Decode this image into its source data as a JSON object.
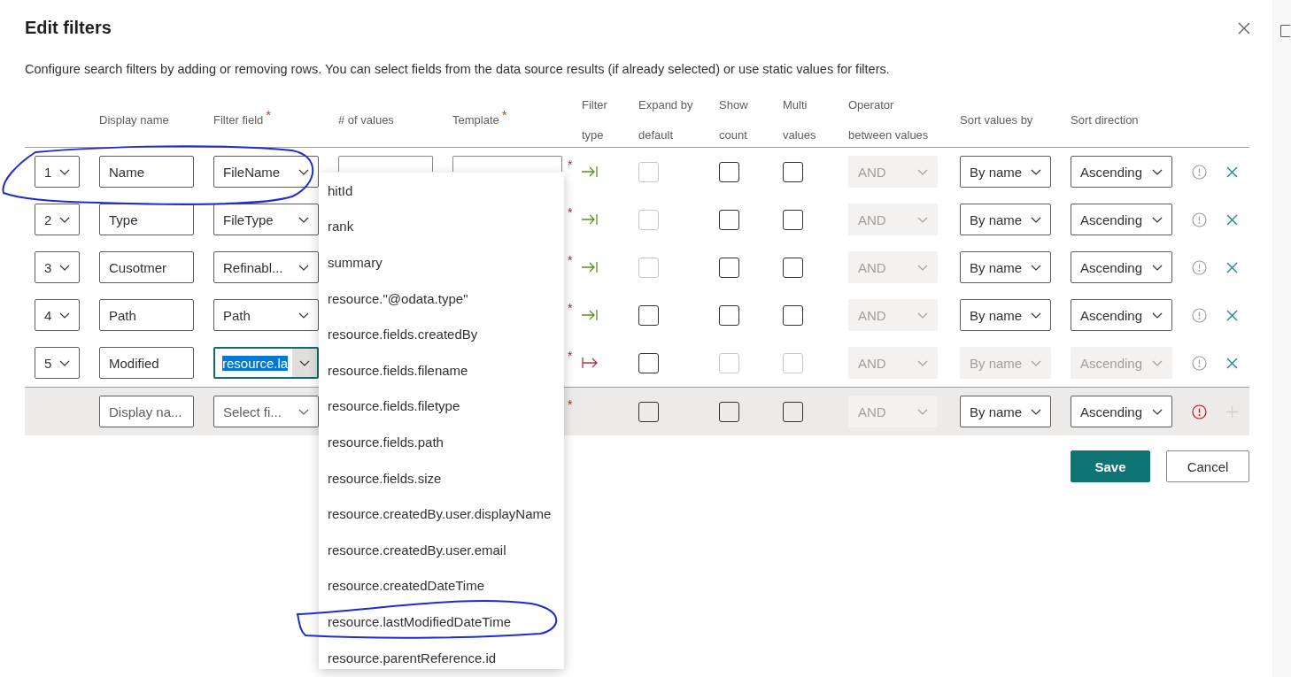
{
  "dialog": {
    "title": "Edit filters",
    "description": "Configure search filters by adding or removing rows. You can select fields from the data source results (if already selected) or use static values for filters."
  },
  "columns": [
    {
      "label": "Display name"
    },
    {
      "label": "Filter field",
      "required_mark": "*"
    },
    {
      "label": "# of values"
    },
    {
      "label": "Template",
      "required_mark": "*"
    },
    {
      "label": "Filter type"
    },
    {
      "label": "Expand by default"
    },
    {
      "label": "Show count"
    },
    {
      "label": "Multi values"
    },
    {
      "label": "Operator between values"
    },
    {
      "label": "Sort values by"
    },
    {
      "label": "Sort direction"
    }
  ],
  "rows": [
    {
      "kind": "filter",
      "index": "1",
      "display_name": "Name",
      "filter_field": "FileName",
      "field_focused": false,
      "template_required_mark": "*",
      "filter_type": {
        "kind": "inline"
      },
      "expand_by_default": {
        "checked": false,
        "disabled": true
      },
      "show_count": {
        "checked": false,
        "disabled": false
      },
      "multi_values": {
        "checked": false,
        "disabled": false
      },
      "operator": {
        "value": "AND",
        "disabled": true
      },
      "sort_by": {
        "value": "By name",
        "disabled": false
      },
      "sort_direction": {
        "value": "Ascending",
        "disabled": false
      },
      "has_error": false,
      "removable": true
    },
    {
      "kind": "filter",
      "index": "2",
      "display_name": "Type",
      "filter_field": "FileType",
      "field_focused": false,
      "template_required_mark": "*",
      "filter_type": {
        "kind": "inline"
      },
      "expand_by_default": {
        "checked": false,
        "disabled": true
      },
      "show_count": {
        "checked": false,
        "disabled": false
      },
      "multi_values": {
        "checked": false,
        "disabled": false
      },
      "operator": {
        "value": "AND",
        "disabled": true
      },
      "sort_by": {
        "value": "By name",
        "disabled": false
      },
      "sort_direction": {
        "value": "Ascending",
        "disabled": false
      },
      "has_error": false,
      "removable": true
    },
    {
      "kind": "filter",
      "index": "3",
      "display_name": "Cusotmer",
      "filter_field": "Refinabl...",
      "field_focused": false,
      "template_required_mark": "*",
      "filter_type": {
        "kind": "inline"
      },
      "expand_by_default": {
        "checked": false,
        "disabled": true
      },
      "show_count": {
        "checked": false,
        "disabled": false
      },
      "multi_values": {
        "checked": false,
        "disabled": false
      },
      "operator": {
        "value": "AND",
        "disabled": true
      },
      "sort_by": {
        "value": "By name",
        "disabled": false
      },
      "sort_direction": {
        "value": "Ascending",
        "disabled": false
      },
      "has_error": false,
      "removable": true
    },
    {
      "kind": "filter",
      "index": "4",
      "display_name": "Path",
      "filter_field": "Path",
      "field_focused": false,
      "template_required_mark": "*",
      "filter_type": {
        "kind": "inline"
      },
      "expand_by_default": {
        "checked": false,
        "disabled": false
      },
      "show_count": {
        "checked": false,
        "disabled": false
      },
      "multi_values": {
        "checked": false,
        "disabled": false
      },
      "operator": {
        "value": "AND",
        "disabled": true
      },
      "sort_by": {
        "value": "By name",
        "disabled": false
      },
      "sort_direction": {
        "value": "Ascending",
        "disabled": false
      },
      "has_error": false,
      "removable": true
    },
    {
      "kind": "filter",
      "index": "5",
      "display_name": "Modified",
      "filter_field": "resource.la",
      "field_focused": true,
      "template_required_mark": "*",
      "filter_type": {
        "kind": "panel"
      },
      "expand_by_default": {
        "checked": false,
        "disabled": false
      },
      "show_count": {
        "checked": false,
        "disabled": true
      },
      "multi_values": {
        "checked": false,
        "disabled": true
      },
      "operator": {
        "value": "AND",
        "disabled": true
      },
      "sort_by": {
        "value": "By name",
        "disabled": true
      },
      "sort_direction": {
        "value": "Ascending",
        "disabled": true
      },
      "has_error": false,
      "removable": true
    },
    {
      "kind": "new",
      "display_name_placeholder": "Display na...",
      "filter_field_placeholder": "Select fi...",
      "template_required_mark": "*",
      "expand_by_default": {
        "checked": false,
        "disabled": false
      },
      "show_count": {
        "checked": false,
        "disabled": false
      },
      "multi_values": {
        "checked": false,
        "disabled": false
      },
      "operator": {
        "value": "AND",
        "disabled": true
      },
      "sort_by": {
        "value": "By name",
        "disabled": false
      },
      "sort_direction": {
        "value": "Ascending",
        "disabled": false
      },
      "has_error": true,
      "removable": false
    }
  ],
  "field_options": [
    {
      "label": "hitId",
      "selected": false
    },
    {
      "label": "rank",
      "selected": false
    },
    {
      "label": "summary",
      "selected": false
    },
    {
      "label": "resource.\"@odata.type\"",
      "selected": false
    },
    {
      "label": "resource.fields.createdBy",
      "selected": false
    },
    {
      "label": "resource.fields.filename",
      "selected": false
    },
    {
      "label": "resource.fields.filetype",
      "selected": false
    },
    {
      "label": "resource.fields.path",
      "selected": false
    },
    {
      "label": "resource.fields.size",
      "selected": false
    },
    {
      "label": "resource.createdBy.user.displayName",
      "selected": false
    },
    {
      "label": "resource.createdBy.user.email",
      "selected": false
    },
    {
      "label": "resource.createdDateTime",
      "selected": false
    },
    {
      "label": "resource.lastModifiedDateTime",
      "selected": false
    },
    {
      "label": "resource.parentReference.id",
      "selected": false
    }
  ],
  "buttons": [
    {
      "label": "Save",
      "kind": "primary"
    },
    {
      "label": "Cancel",
      "kind": "secondary"
    }
  ]
}
